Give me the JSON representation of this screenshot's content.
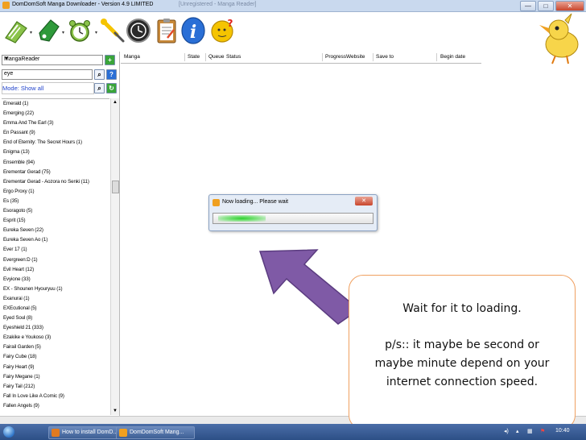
{
  "window": {
    "title": "DomDomSoft Manga Downloader - Version 4.9 LIMITED",
    "title_ghost": "[Unregistered - Manga Reader]",
    "controls": [
      "—",
      "□",
      "✕"
    ]
  },
  "toolbar": {
    "icons": [
      "book-add-icon",
      "tag-icon",
      "alarm-clock-icon",
      "wrench-icon",
      "history-clock-icon",
      "clipboard-icon",
      "info-icon",
      "help-icon"
    ]
  },
  "sidebar": {
    "source": "MangaReader",
    "search_value": "eye",
    "mode": "Mode: Show all",
    "items": [
      "Emerald (1)",
      "Emerging (22)",
      "Emma And The Earl (3)",
      "En Passant (9)",
      "End of Eternity: The Secret Hours (1)",
      "Enigma (13)",
      "Ensemble (94)",
      "Erementar Gerad (75)",
      "Erementar Gerad - Aozora no Senki (11)",
      "Ergo Proxy (1)",
      "Es (35)",
      "Esoragoto (5)",
      "Esprit (15)",
      "Eureka Seven (22)",
      "Eureka Seven Ao (1)",
      "Ever 17 (1)",
      "Evergreen:D (1)",
      "Evil Heart (12)",
      "Evyione (33)",
      "EX - Shounen Hyouryuu (1)",
      "Exanurai (1)",
      "EXEcutional (5)",
      "Eyed Soul (8)",
      "Eyeshield 21 (333)",
      "Ezakike e Youkoso (3)",
      "Fairail Garden (5)",
      "Fairy Cube (18)",
      "Fairy Heart (9)",
      "Fairy Megane (1)",
      "Fairy Tail (212)",
      "Fall In Love Like A Comic (9)",
      "Fallen Angels (9)"
    ]
  },
  "columns": [
    "Manga",
    "State",
    "Queue",
    "Status",
    "Progress",
    "Website",
    "Save to",
    "Begin date"
  ],
  "dialog": {
    "title": "Now loading... Please wait",
    "close": "✕",
    "progress": 0.3
  },
  "callout": {
    "line1": "Wait for it to loading.",
    "line2": "p/s:: it maybe be second or maybe minute depend on your internet connection speed."
  },
  "taskbar": {
    "items": [
      "How to install DomD...",
      "DomDomSoft Mang..."
    ],
    "clock": "10:40"
  }
}
